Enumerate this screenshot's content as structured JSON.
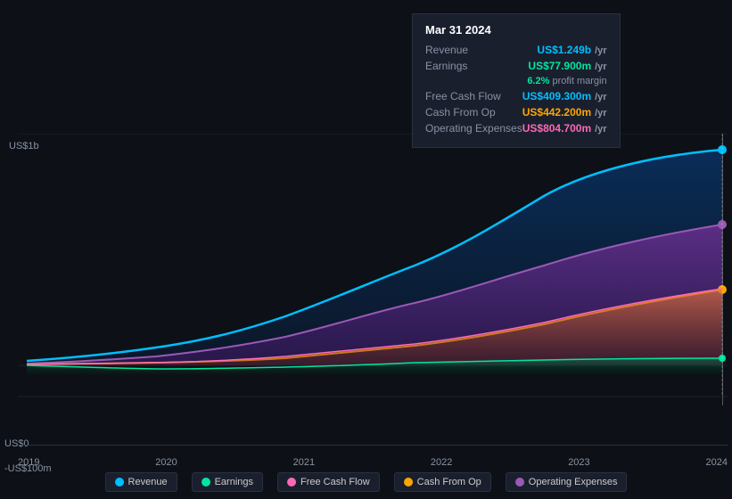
{
  "tooltip": {
    "date": "Mar 31 2024",
    "revenue_label": "Revenue",
    "revenue_value": "US$1.249b",
    "revenue_suffix": "/yr",
    "earnings_label": "Earnings",
    "earnings_value": "US$77.900m",
    "earnings_suffix": "/yr",
    "profit_margin_pct": "6.2%",
    "profit_margin_label": "profit margin",
    "fcf_label": "Free Cash Flow",
    "fcf_value": "US$409.300m",
    "fcf_suffix": "/yr",
    "cashfromop_label": "Cash From Op",
    "cashfromop_value": "US$442.200m",
    "cashfromop_suffix": "/yr",
    "opex_label": "Operating Expenses",
    "opex_value": "US$804.700m",
    "opex_suffix": "/yr"
  },
  "yaxis": {
    "title": "US$1b",
    "labels": [
      "US$1b",
      "US$0",
      "-US$100m"
    ]
  },
  "xaxis": {
    "labels": [
      "2019",
      "2020",
      "2021",
      "2022",
      "2023",
      "2024"
    ]
  },
  "legend": [
    {
      "id": "revenue",
      "label": "Revenue",
      "color": "#00bfff"
    },
    {
      "id": "earnings",
      "label": "Earnings",
      "color": "#00e5a0"
    },
    {
      "id": "fcf",
      "label": "Free Cash Flow",
      "color": "#ff69b4"
    },
    {
      "id": "cashfromop",
      "label": "Cash From Op",
      "color": "#ffa500"
    },
    {
      "id": "opex",
      "label": "Operating Expenses",
      "color": "#9b59b6"
    }
  ],
  "colors": {
    "background": "#0d1117",
    "tooltip_bg": "#1a1f2e",
    "grid": "#2a3040",
    "text_secondary": "#8892a4"
  }
}
